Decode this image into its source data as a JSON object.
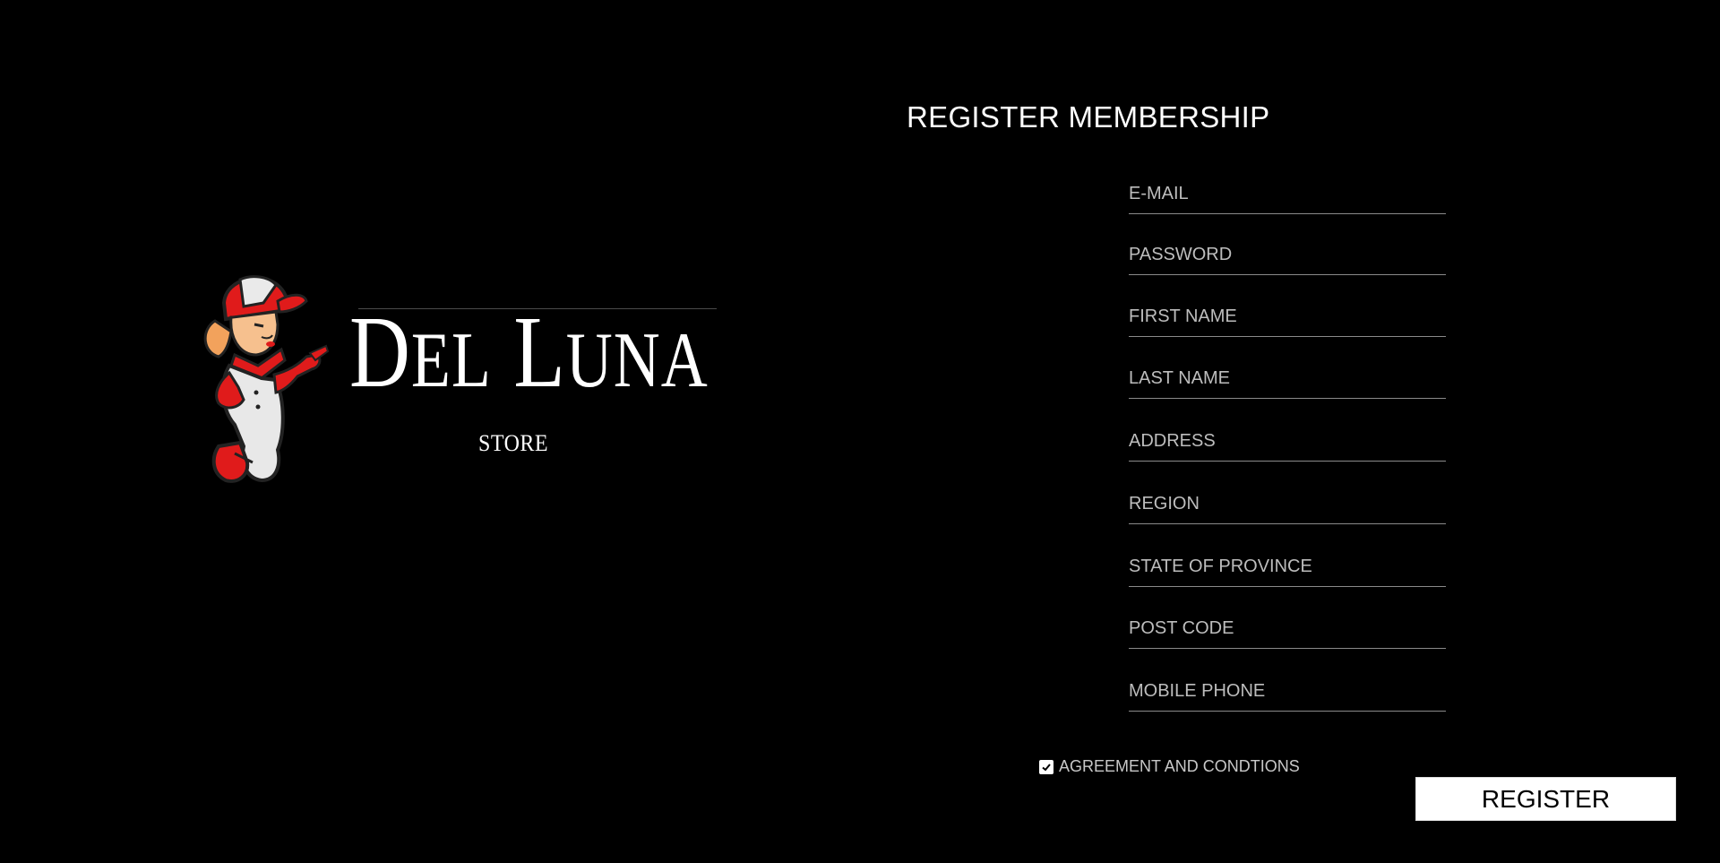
{
  "brand": {
    "name_first": "D",
    "name_first_rest": "EL",
    "name_second": "L",
    "name_second_rest": "UNA",
    "subtitle": "STORE"
  },
  "form": {
    "title": "REGISTER MEMBERSHIP",
    "fields": [
      {
        "name": "email",
        "placeholder": "E-MAIL",
        "value": ""
      },
      {
        "name": "password",
        "placeholder": "PASSWORD",
        "value": ""
      },
      {
        "name": "first-name",
        "placeholder": "FIRST NAME",
        "value": ""
      },
      {
        "name": "last-name",
        "placeholder": "LAST NAME",
        "value": ""
      },
      {
        "name": "address",
        "placeholder": "ADDRESS",
        "value": ""
      },
      {
        "name": "region",
        "placeholder": "REGION",
        "value": ""
      },
      {
        "name": "state-of-province",
        "placeholder": "STATE OF PROVINCE",
        "value": ""
      },
      {
        "name": "post-code",
        "placeholder": "POST CODE",
        "value": ""
      },
      {
        "name": "mobile-phone",
        "placeholder": "MOBILE PHONE",
        "value": ""
      }
    ],
    "agreement": {
      "label": "AGREEMENT AND CONDTIONS",
      "checked": true
    },
    "submit_label": "REGISTER"
  },
  "colors": {
    "background": "#000000",
    "text": "#ffffff",
    "placeholder": "#bdbdbd",
    "underline": "#8a8a8a",
    "mascot_red": "#e01b1b",
    "mascot_skin": "#f2a25c"
  }
}
